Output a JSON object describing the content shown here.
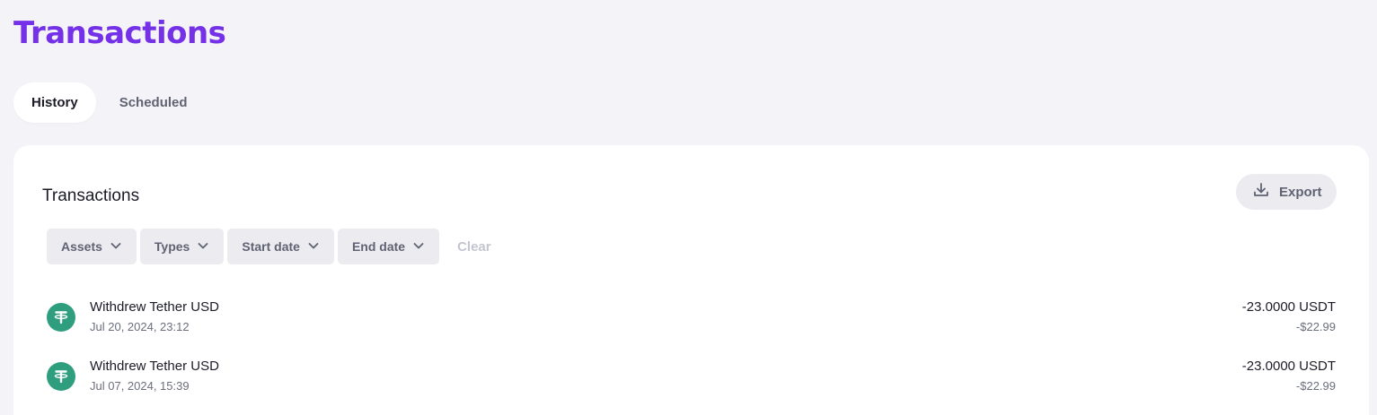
{
  "page": {
    "title": "Transactions"
  },
  "tabs": [
    {
      "label": "History",
      "active": true
    },
    {
      "label": "Scheduled",
      "active": false
    }
  ],
  "card": {
    "title": "Transactions",
    "export_label": "Export",
    "export_icon": "download-icon"
  },
  "filters": {
    "items": [
      {
        "label": "Assets",
        "icon": "chevron-down-icon"
      },
      {
        "label": "Types",
        "icon": "chevron-down-icon"
      },
      {
        "label": "Start date",
        "icon": "chevron-down-icon"
      },
      {
        "label": "End date",
        "icon": "chevron-down-icon"
      }
    ],
    "clear_label": "Clear"
  },
  "transactions": [
    {
      "title": "Withdrew Tether USD",
      "date": "Jul 20, 2024, 23:12",
      "amount": "-23.0000 USDT",
      "fiat": "-$22.99",
      "icon": "tether-icon"
    },
    {
      "title": "Withdrew Tether USD",
      "date": "Jul 07, 2024, 15:39",
      "amount": "-23.0000 USDT",
      "fiat": "-$22.99",
      "icon": "tether-icon"
    }
  ],
  "colors": {
    "brand": "#7431e8",
    "tether": "#2e9e7e",
    "background": "#f4f4f8"
  }
}
